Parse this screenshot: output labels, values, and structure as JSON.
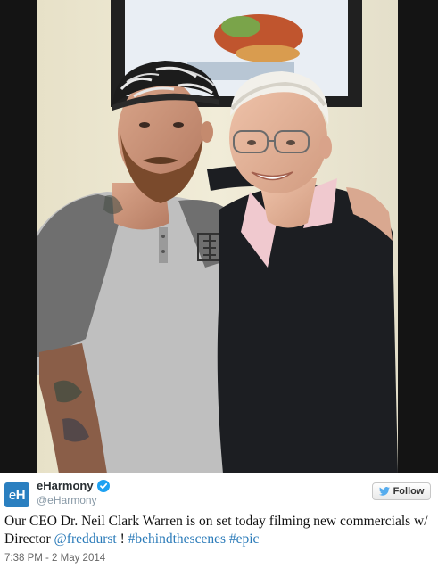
{
  "tweet": {
    "display_name": "eHarmony",
    "handle": "@eHarmony",
    "avatar_text_a": "e",
    "avatar_text_b": "H",
    "follow_label": "Follow",
    "text_part1": "Our CEO Dr. Neil Clark Warren is on set today filming new commercials w/ Director ",
    "mention": "@freddurst",
    "text_part2": " ! ",
    "hashtag1": "#behindthescenes",
    "text_part3": " ",
    "hashtag2": "#epic",
    "timestamp": "7:38 PM - 2 May 2014"
  },
  "colors": {
    "link": "#2b7bb9",
    "avatar_bg": "#2a7fc0",
    "verified": "#1da1f2"
  },
  "icons": {
    "verified": "verified-badge-icon",
    "follow": "twitter-bird-icon"
  }
}
